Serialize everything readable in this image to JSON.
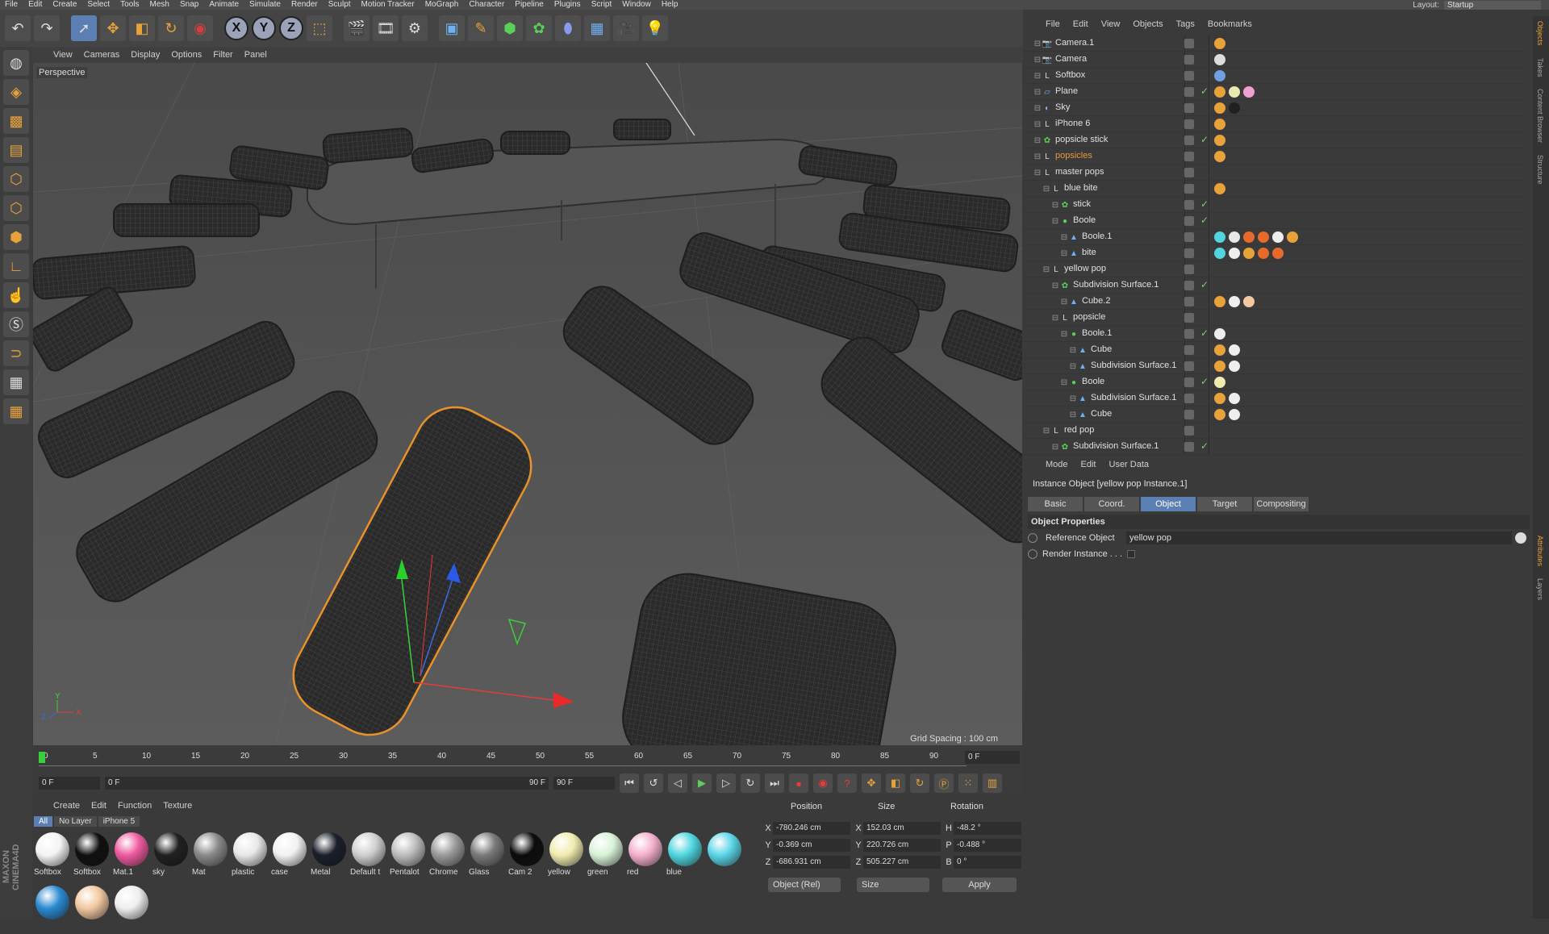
{
  "menubar": {
    "items": [
      "File",
      "Edit",
      "Create",
      "Select",
      "Tools",
      "Mesh",
      "Snap",
      "Animate",
      "Simulate",
      "Render",
      "Sculpt",
      "Motion Tracker",
      "MoGraph",
      "Character",
      "Pipeline",
      "Plugins",
      "Script",
      "Window",
      "Help"
    ]
  },
  "layout": {
    "label": "Layout:",
    "value": "Startup"
  },
  "toolbar": {
    "x": "X",
    "y": "Y",
    "z": "Z"
  },
  "viewport": {
    "menu": [
      "View",
      "Cameras",
      "Display",
      "Options",
      "Filter",
      "Panel"
    ],
    "label": "Perspective",
    "grid_spacing": "Grid Spacing : 100 cm"
  },
  "timeline": {
    "ticks": [
      "0",
      "5",
      "10",
      "15",
      "20",
      "25",
      "30",
      "35",
      "40",
      "45",
      "50",
      "55",
      "60",
      "65",
      "70",
      "75",
      "80",
      "85",
      "90"
    ],
    "frame": "0 F",
    "start": "0 F",
    "range_start": "0 F",
    "range_end": "90 F",
    "end": "90 F"
  },
  "materials": {
    "menu": [
      "Create",
      "Edit",
      "Function",
      "Texture"
    ],
    "tabs": [
      "All",
      "No Layer",
      "iPhone 5"
    ],
    "items": [
      {
        "name": "Softbox",
        "color": "#f4f4f4"
      },
      {
        "name": "Softbox",
        "color": "#101010"
      },
      {
        "name": "Mat.1",
        "color": "#ee5aa0"
      },
      {
        "name": "sky",
        "color": "#202020"
      },
      {
        "name": "Mat",
        "color": "#8a8a8a"
      },
      {
        "name": "plastic",
        "color": "#e8e8e8"
      },
      {
        "name": "case",
        "color": "#f2f2f2"
      },
      {
        "name": "Metal",
        "color": "#1a1f2a"
      },
      {
        "name": "Default t",
        "color": "#cfcfcf"
      },
      {
        "name": "Pentalot",
        "color": "#bdbdbd"
      },
      {
        "name": "Chrome",
        "color": "#9a9a9a"
      },
      {
        "name": "Glass",
        "color": "#7a7a7a"
      },
      {
        "name": "Cam 2",
        "color": "#0c0c0c"
      },
      {
        "name": "yellow",
        "color": "#f0ecb0"
      },
      {
        "name": "green",
        "color": "#d8f2d8"
      },
      {
        "name": "red",
        "color": "#f4b0cc"
      },
      {
        "name": "blue",
        "color": "#4fd6e0"
      },
      {
        "name": "",
        "color": "#5ad6e8"
      },
      {
        "name": "",
        "color": "#2a8ad0"
      },
      {
        "name": "",
        "color": "#f2c8a0"
      },
      {
        "name": "",
        "color": "#eeeeee"
      }
    ]
  },
  "coords": {
    "headers": [
      "Position",
      "Size",
      "Rotation"
    ],
    "rows": [
      {
        "axis": "X",
        "pos": "-780.246 cm",
        "size_axis": "X",
        "size": "152.03 cm",
        "rot_axis": "H",
        "rot": "-48.2 °"
      },
      {
        "axis": "Y",
        "pos": "-0.369 cm",
        "size_axis": "Y",
        "size": "220.726 cm",
        "rot_axis": "P",
        "rot": "-0.488 °"
      },
      {
        "axis": "Z",
        "pos": "-686.931 cm",
        "size_axis": "Z",
        "size": "505.227 cm",
        "rot_axis": "B",
        "rot": "0 °"
      }
    ],
    "mode": "Object (Rel)",
    "size_mode": "Size",
    "apply": "Apply"
  },
  "objects": {
    "menu": [
      "File",
      "Edit",
      "View",
      "Objects",
      "Tags",
      "Bookmarks"
    ],
    "rows": [
      {
        "name": "Camera.1",
        "depth": 0,
        "icon": "camera-icon",
        "check": false,
        "tags": [
          "#e8a23a"
        ]
      },
      {
        "name": "Camera",
        "depth": 0,
        "icon": "camera-icon",
        "check": false,
        "tags": [
          "#dddddd"
        ]
      },
      {
        "name": "Softbox",
        "depth": 0,
        "icon": "null-icon",
        "check": false,
        "tags": [
          "#6fa0e0"
        ]
      },
      {
        "name": "Plane",
        "depth": 0,
        "icon": "plane-icon",
        "check": true,
        "tags": [
          "#e8a23a",
          "#e8e8b0",
          "#f0a0d0"
        ]
      },
      {
        "name": "Sky",
        "depth": 0,
        "icon": "sky-icon",
        "check": false,
        "tags": [
          "#e8a23a",
          "#202020"
        ]
      },
      {
        "name": "iPhone 6",
        "depth": 0,
        "icon": "null-icon",
        "check": false,
        "tags": [
          "#e8a23a"
        ]
      },
      {
        "name": "popsicle stick",
        "depth": 0,
        "icon": "generator-icon",
        "check": true,
        "tags": [
          "#e8a23a"
        ]
      },
      {
        "name": "popsicles",
        "depth": 0,
        "icon": "null-icon",
        "check": false,
        "tags": [
          "#e8a23a"
        ],
        "orange": true
      },
      {
        "name": "master pops",
        "depth": 0,
        "icon": "null-icon",
        "check": false,
        "tags": []
      },
      {
        "name": "blue bite",
        "depth": 1,
        "icon": "null-icon",
        "check": false,
        "tags": [
          "#e8a23a"
        ]
      },
      {
        "name": "stick",
        "depth": 2,
        "icon": "generator-icon",
        "check": true,
        "tags": []
      },
      {
        "name": "Boole",
        "depth": 2,
        "icon": "boole-icon",
        "check": true,
        "tags": []
      },
      {
        "name": "Boole.1",
        "depth": 3,
        "icon": "poly-icon",
        "check": false,
        "tags": [
          "#4fd6e0",
          "#e8e8e8",
          "#e86a2a",
          "#e86a2a",
          "#eeeeee",
          "#e8a23a"
        ]
      },
      {
        "name": "bite",
        "depth": 3,
        "icon": "poly-icon",
        "check": false,
        "tags": [
          "#4fd6e0",
          "#eeeeee",
          "#e8a23a",
          "#e86a2a",
          "#e86a2a"
        ]
      },
      {
        "name": "yellow pop",
        "depth": 1,
        "icon": "null-icon",
        "check": false,
        "tags": []
      },
      {
        "name": "Subdivision Surface.1",
        "depth": 2,
        "icon": "generator-icon",
        "check": true,
        "tags": []
      },
      {
        "name": "Cube.2",
        "depth": 3,
        "icon": "poly-icon",
        "check": false,
        "tags": [
          "#e8a23a",
          "#eeeeee",
          "#f2c8a0"
        ]
      },
      {
        "name": "popsicle",
        "depth": 2,
        "icon": "null-icon",
        "check": false,
        "tags": []
      },
      {
        "name": "Boole.1",
        "depth": 3,
        "icon": "boole-icon",
        "check": true,
        "tags": [
          "#eeeeee"
        ]
      },
      {
        "name": "Cube",
        "depth": 4,
        "icon": "poly-icon",
        "check": false,
        "tags": [
          "#e8a23a",
          "#eeeeee"
        ]
      },
      {
        "name": "Subdivision Surface.1",
        "depth": 4,
        "icon": "poly-icon",
        "check": false,
        "tags": [
          "#e8a23a",
          "#eeeeee"
        ]
      },
      {
        "name": "Boole",
        "depth": 3,
        "icon": "boole-icon",
        "check": true,
        "tags": [
          "#f0ecb0"
        ]
      },
      {
        "name": "Subdivision Surface.1",
        "depth": 4,
        "icon": "poly-icon",
        "check": false,
        "tags": [
          "#e8a23a",
          "#eeeeee"
        ]
      },
      {
        "name": "Cube",
        "depth": 4,
        "icon": "poly-icon",
        "check": false,
        "tags": [
          "#e8a23a",
          "#eeeeee"
        ]
      },
      {
        "name": "red pop",
        "depth": 1,
        "icon": "null-icon",
        "check": false,
        "tags": []
      },
      {
        "name": "Subdivision Surface.1",
        "depth": 2,
        "icon": "generator-icon",
        "check": true,
        "tags": []
      }
    ]
  },
  "attributes": {
    "menu": [
      "Mode",
      "Edit",
      "User Data"
    ],
    "title": "Instance Object [yellow pop Instance.1]",
    "tabs": [
      "Basic",
      "Coord.",
      "Object",
      "Target",
      "Compositing"
    ],
    "active_tab": "Object",
    "section": "Object Properties",
    "ref_label": "Reference Object",
    "ref_value": "yellow pop",
    "render_label": "Render Instance . . ."
  },
  "sidetabs": [
    "Objects",
    "Takes",
    "Content Browser",
    "Structure",
    "Attributes",
    "Layers"
  ]
}
